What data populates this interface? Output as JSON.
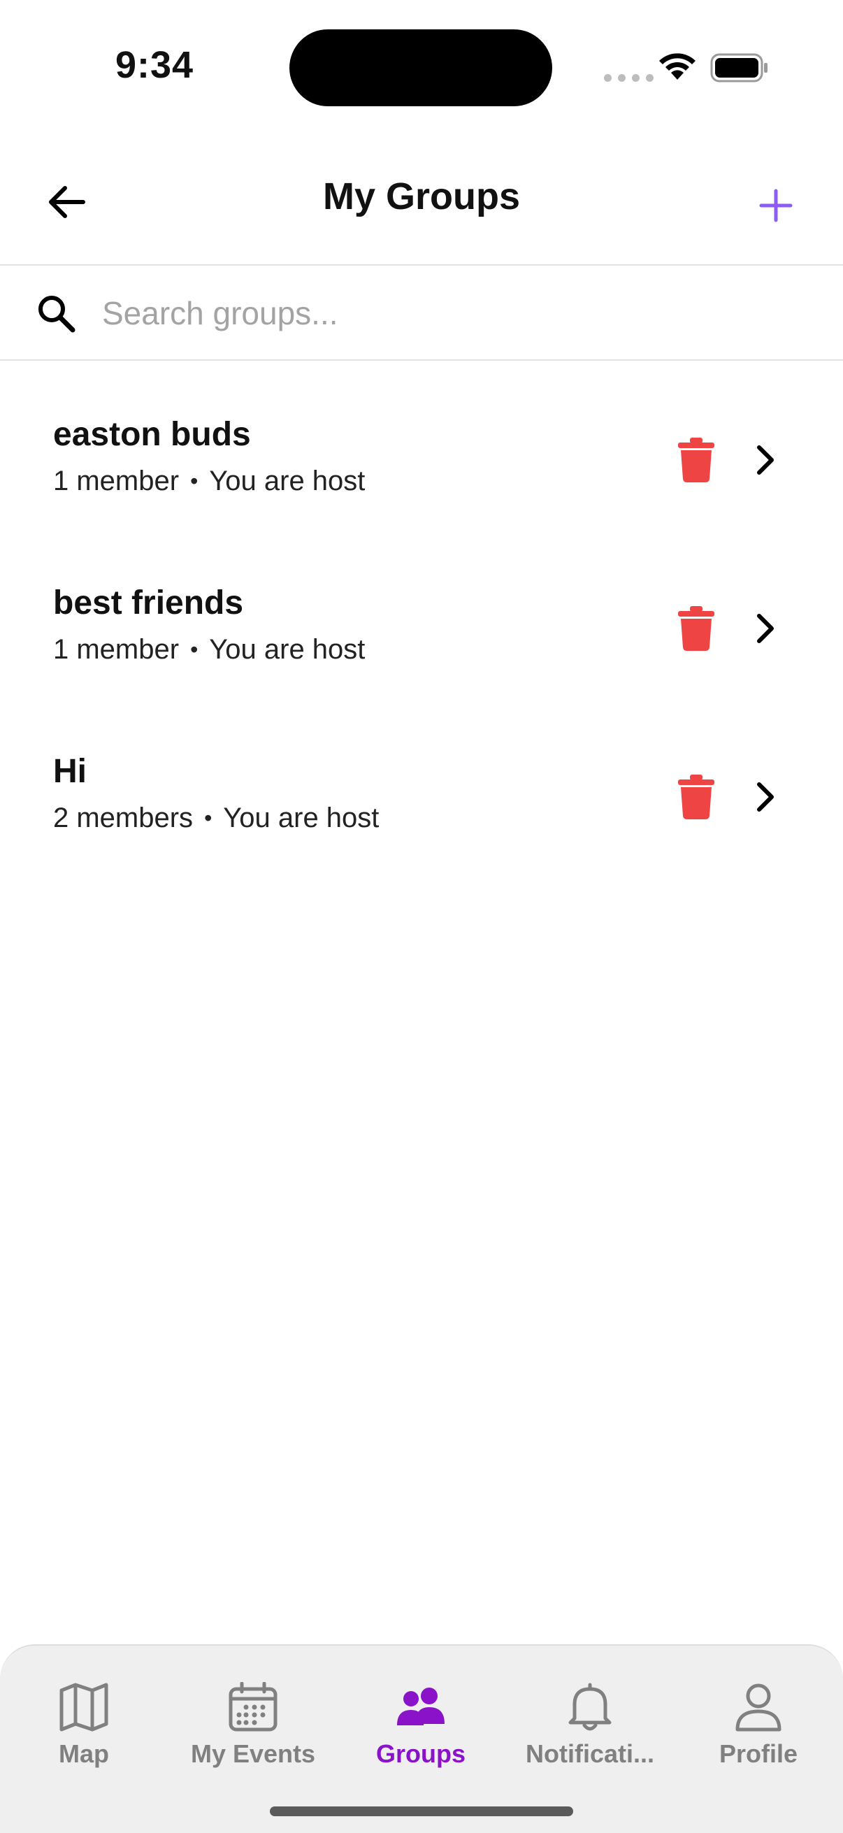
{
  "status_bar": {
    "time": "9:34"
  },
  "header": {
    "title": "My Groups"
  },
  "search": {
    "placeholder": "Search groups...",
    "value": ""
  },
  "groups": [
    {
      "name": "easton buds",
      "members": "1 member",
      "role": "You are host"
    },
    {
      "name": "best friends",
      "members": "1 member",
      "role": "You are host"
    },
    {
      "name": "Hi",
      "members": "2 members",
      "role": "You are host"
    }
  ],
  "tab_bar": {
    "active": "Groups",
    "items": [
      {
        "label": "Map",
        "icon": "map-icon"
      },
      {
        "label": "My Events",
        "icon": "calendar-icon"
      },
      {
        "label": "Groups",
        "icon": "people-icon"
      },
      {
        "label": "Notificati...",
        "icon": "bell-icon"
      },
      {
        "label": "Profile",
        "icon": "person-icon"
      }
    ]
  },
  "colors": {
    "accent": "#8a12c9",
    "add": "#8b5cf6",
    "delete": "#ef4444",
    "inactive_tab": "#808080",
    "tab_background": "#efefef"
  }
}
